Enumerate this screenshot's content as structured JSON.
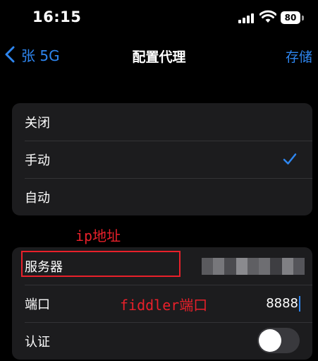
{
  "status": {
    "time": "16:15",
    "battery": "80"
  },
  "nav": {
    "back_label": "张 5G",
    "title": "配置代理",
    "save_label": "存储"
  },
  "modes": [
    {
      "label": "关闭",
      "selected": false
    },
    {
      "label": "手动",
      "selected": true
    },
    {
      "label": "自动",
      "selected": false
    }
  ],
  "annotations": {
    "ip": "ip地址",
    "port": "fiddler端口"
  },
  "settings": {
    "server_label": "服务器",
    "port_label": "端口",
    "port_value": "8888",
    "auth_label": "认证",
    "auth_enabled": false
  },
  "colors": {
    "accent": "#2e86f0",
    "annotation": "#e8202a",
    "background": "#000000",
    "cell": "#1c1c1e"
  }
}
